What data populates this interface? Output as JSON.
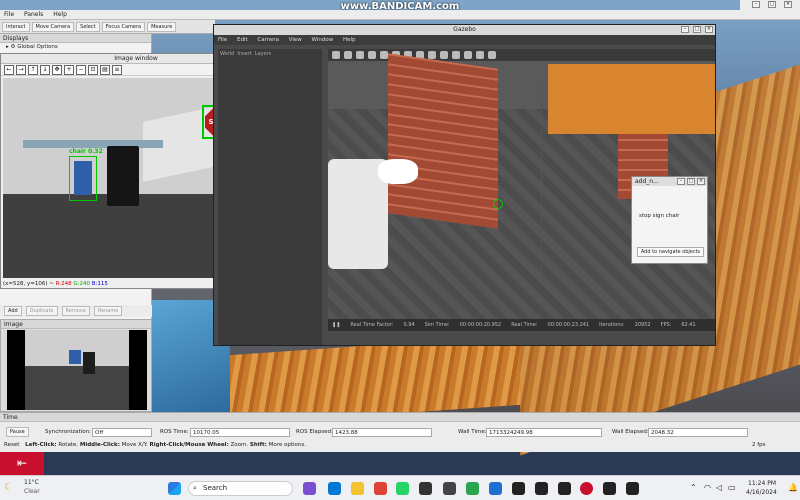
{
  "watermark": "www.BANDICAM.com",
  "rviz": {
    "menu": [
      "File",
      "Panels",
      "Help"
    ],
    "toolbar": [
      "Interact",
      "Move Camera",
      "Select",
      "Focus Camera",
      "Measure"
    ],
    "displays_header": "Displays",
    "global_options": "Global Options",
    "buttons": [
      "Add",
      "Duplicate",
      "Remove",
      "Rename"
    ],
    "image_panel_header": "Image"
  },
  "image_window": {
    "title": "Image window",
    "detections": [
      {
        "label": "STOP",
        "box_label": ""
      },
      {
        "label": "chair",
        "score_text": "chair 0.32"
      }
    ],
    "status": "(x=528, y=106) ~ R:248 G:240 B:115",
    "status_parts": {
      "coord": "(x=528, y=106) ~",
      "r": "R:248",
      "g": "G:240",
      "b": "B:115"
    }
  },
  "gazebo": {
    "title": "Gazebo",
    "menu": [
      "File",
      "Edit",
      "Camera",
      "View",
      "Window",
      "Help"
    ],
    "left_tabs": [
      "World",
      "Insert",
      "Layers"
    ],
    "status": {
      "rtf_label": "Real Time Factor:",
      "rtf_value": "0.94",
      "sim_label": "Sim Time:",
      "sim_value": "00:00:00:20.952",
      "real_label": "Real Time:",
      "real_value": "00:00:00:23.241",
      "iter_label": "Iterations:",
      "iter_value": "20952",
      "fps_label": "FPS:",
      "fps_value": "62.41"
    }
  },
  "add_nav": {
    "title": "add_n...",
    "objects_text": "stop sign chair",
    "button": "Add to navigate objects"
  },
  "time_bar": {
    "header": "Time",
    "pause": "Pause",
    "sync_label": "Synchronization:",
    "sync_value": "Off",
    "ros_time_label": "ROS Time:",
    "ros_time": "10170.05",
    "ros_elapsed_label": "ROS Elapsed:",
    "ros_elapsed": "1423.88",
    "wall_time_label": "Wall Time:",
    "wall_time": "1713324249.98",
    "wall_elapsed_label": "Wall Elapsed:",
    "wall_elapsed": "2048.32",
    "reset": "Reset",
    "hint_1": "Left-Click:",
    "hint_1b": " Rotate. ",
    "hint_2": "Middle-Click:",
    "hint_2b": " Move X/Y. ",
    "hint_3": "Right-Click/Mouse Wheel:",
    "hint_3b": " Zoom. ",
    "hint_4": "Shift:",
    "hint_4b": " More options.",
    "fps": "2 fps"
  },
  "taskbar": {
    "weather_temp": "11°C",
    "weather_desc": "Clear",
    "search": "Search",
    "time": "11:24 PM",
    "date": "4/16/2024"
  },
  "colors": {
    "detection_box": "#00c800",
    "stop_sign": "#b81d1d",
    "rviz_bg": "#ececec",
    "gazebo_bg": "#4a4a4a"
  }
}
